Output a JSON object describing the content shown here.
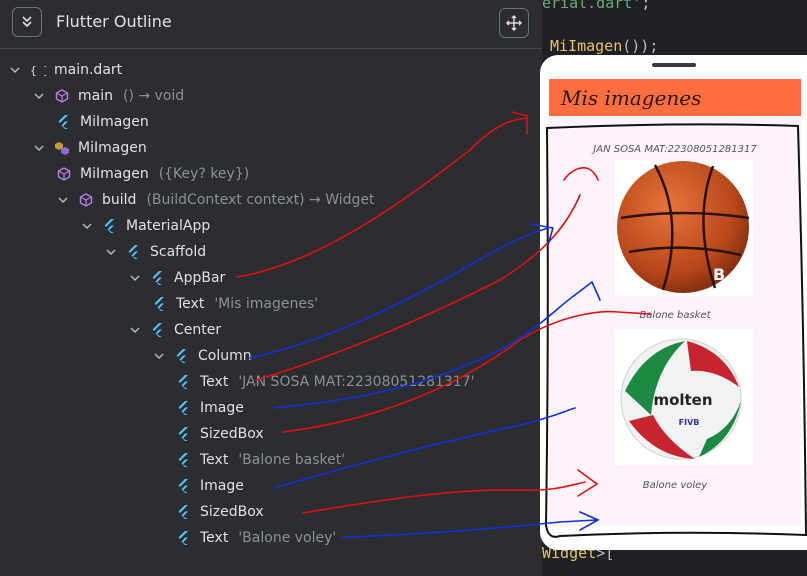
{
  "outline": {
    "title": "Flutter Outline",
    "rows": [
      {
        "label": "main.dart",
        "sig": ""
      },
      {
        "label": "main",
        "sig": "() → void"
      },
      {
        "label": "MiImagen",
        "sig": ""
      },
      {
        "label": "MiImagen",
        "sig": ""
      },
      {
        "label": "MiImagen",
        "sig": "({Key? key})"
      },
      {
        "label": "build",
        "sig": "(BuildContext context) → Widget"
      },
      {
        "label": "MaterialApp",
        "sig": ""
      },
      {
        "label": "Scaffold",
        "sig": ""
      },
      {
        "label": "AppBar",
        "sig": ""
      },
      {
        "label": "Text",
        "sig": "'Mis imagenes'"
      },
      {
        "label": "Center",
        "sig": ""
      },
      {
        "label": "Column",
        "sig": ""
      },
      {
        "label": "Text",
        "sig": "'JAN SOSA MAT:22308051281317'"
      },
      {
        "label": "Image",
        "sig": ""
      },
      {
        "label": "SizedBox",
        "sig": ""
      },
      {
        "label": "Text",
        "sig": "'Balone basket'"
      },
      {
        "label": "Image",
        "sig": ""
      },
      {
        "label": "SizedBox",
        "sig": ""
      },
      {
        "label": "Text",
        "sig": "'Balone voley'"
      }
    ]
  },
  "code": {
    "line1_str": "erial.dart'",
    "line1_end": ";",
    "line2_fn": "MiImagen",
    "line2_end": "());",
    "line3_word": "Widget",
    "line3_end": ">["
  },
  "phone": {
    "appbar_title": "Mis imagenes",
    "student_text": "JAN SOSA MAT:22308051281317",
    "caption1": "Balone basket",
    "caption2": "Balone voley",
    "ball1_text": "B",
    "ball2_brand": "molten",
    "ball2_sub": "FIVB"
  },
  "colors": {
    "appbar": "#ff6e40",
    "panel_bg": "#2b2d30",
    "flutter_icon": "#4fc3f7",
    "purple_icon": "#b67ee6",
    "annotation_red": "#e01010",
    "annotation_blue": "#1030d8"
  }
}
